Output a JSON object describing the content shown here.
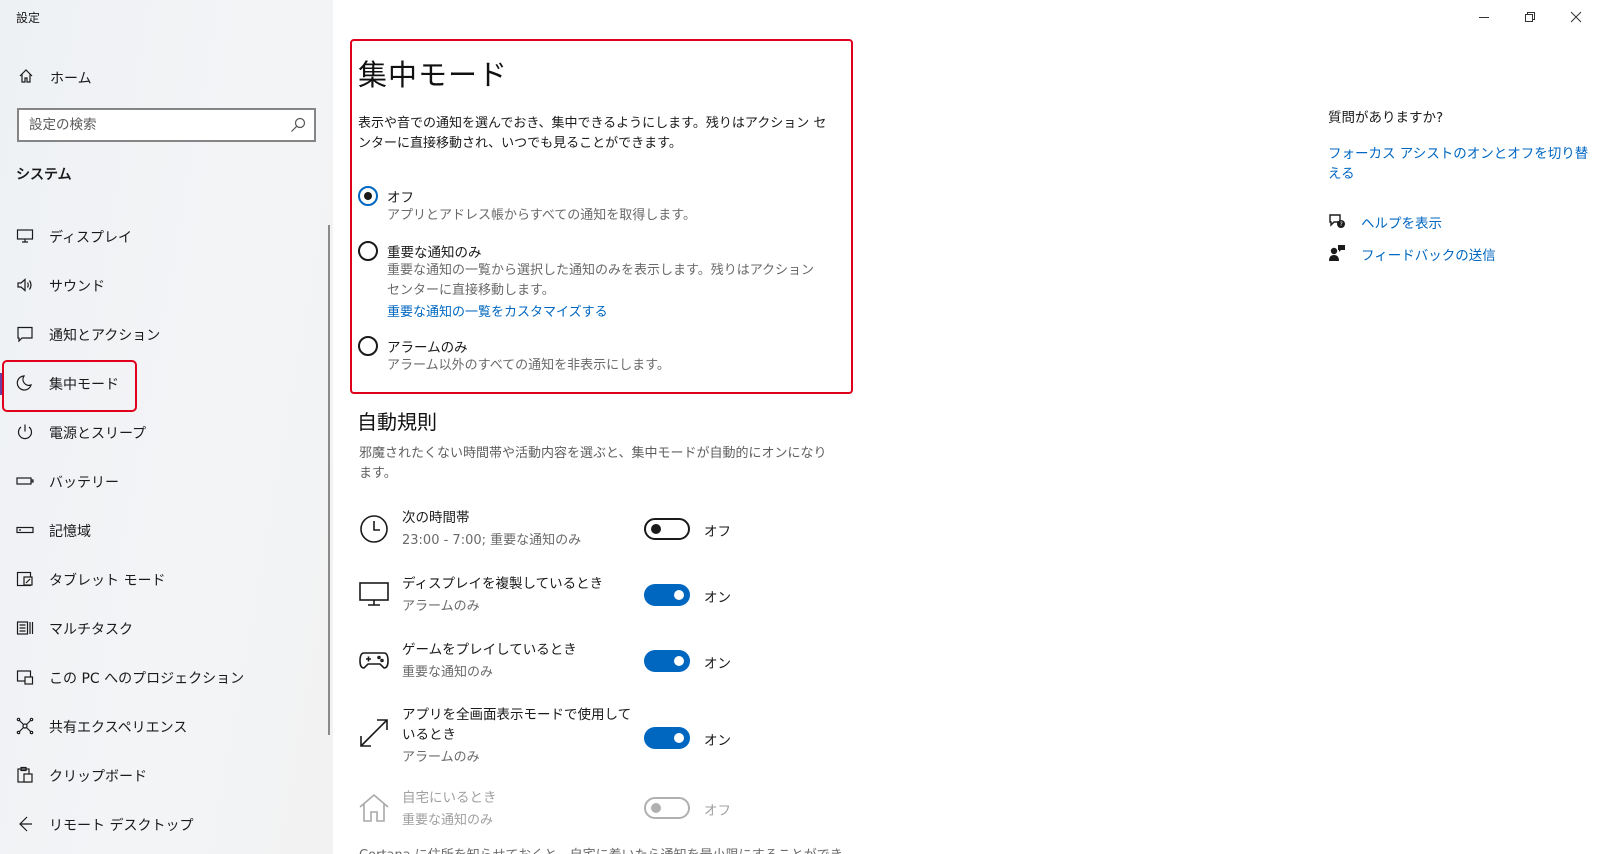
{
  "window": {
    "title": "設定",
    "controls": {
      "minimize": "minimize-icon",
      "restore": "restore-icon",
      "close": "close-icon"
    }
  },
  "sidebar": {
    "home": {
      "icon": "home-icon",
      "label": "ホーム"
    },
    "search": {
      "placeholder": "設定の検索",
      "value": "",
      "icon": "search-icon"
    },
    "section": "システム",
    "items": [
      {
        "icon": "display-icon",
        "label": "ディスプレイ"
      },
      {
        "icon": "sound-icon",
        "label": "サウンド"
      },
      {
        "icon": "notification-icon",
        "label": "通知とアクション"
      },
      {
        "icon": "moon-icon",
        "label": "集中モード",
        "active": true
      },
      {
        "icon": "power-icon",
        "label": "電源とスリープ"
      },
      {
        "icon": "battery-icon",
        "label": "バッテリー"
      },
      {
        "icon": "storage-icon",
        "label": "記憶域"
      },
      {
        "icon": "tablet-icon",
        "label": "タブレット モード"
      },
      {
        "icon": "multitask-icon",
        "label": "マルチタスク"
      },
      {
        "icon": "projection-icon",
        "label": "この PC へのプロジェクション"
      },
      {
        "icon": "shared-experience-icon",
        "label": "共有エクスペリエンス"
      },
      {
        "icon": "clipboard-icon",
        "label": "クリップボード"
      },
      {
        "icon": "remote-desktop-icon",
        "label": "リモート デスクトップ"
      }
    ],
    "highlight_color": "#e0001b",
    "active_bar_color": "#6b3fa0"
  },
  "main": {
    "title": "集中モード",
    "description": "表示や音での通知を選んでおき、集中できるようにします。残りはアクション センターに直接移動され、いつでも見ることができます。",
    "options": [
      {
        "label": "オフ",
        "sub": "アプリとアドレス帳からすべての通知を取得します。",
        "checked": true
      },
      {
        "label": "重要な通知のみ",
        "sub": "重要な通知の一覧から選択した通知のみを表示します。残りはアクション センターに直接移動します。",
        "link": "重要な通知の一覧をカスタマイズする",
        "checked": false
      },
      {
        "label": "アラームのみ",
        "sub": "アラーム以外のすべての通知を非表示にします。",
        "checked": false
      }
    ],
    "auto_rules": {
      "title": "自動規則",
      "description": "邪魔されたくない時間帯や活動内容を選ぶと、集中モードが自動的にオンになります。",
      "rules": [
        {
          "icon": "clock-icon",
          "name": "次の時間帯",
          "sub": "23:00 - 7:00; 重要な通知のみ",
          "on": false,
          "state": "オフ",
          "disabled": false
        },
        {
          "icon": "monitor-icon",
          "name": "ディスプレイを複製しているとき",
          "sub": "アラームのみ",
          "on": true,
          "state": "オン",
          "disabled": false
        },
        {
          "icon": "gamepad-icon",
          "name": "ゲームをプレイしているとき",
          "sub": "重要な通知のみ",
          "on": true,
          "state": "オン",
          "disabled": false
        },
        {
          "icon": "fullscreen-icon",
          "name": "アプリを全画面表示モードで使用しているとき",
          "sub": "アラームのみ",
          "on": true,
          "state": "オン",
          "disabled": false
        },
        {
          "icon": "house-icon",
          "name": "自宅にいるとき",
          "sub": "重要な通知のみ",
          "on": false,
          "state": "オフ",
          "disabled": true
        }
      ],
      "footer": "Cortana に住所を知らせておくと、自宅に着いたら通知を最小限にすることができ"
    },
    "accent_color": "#0067c0"
  },
  "right_panel": {
    "question": "質問がありますか?",
    "link": "フォーカス アシストのオンとオフを切り替える",
    "items": [
      {
        "icon": "help-chat-icon",
        "label": "ヘルプを表示"
      },
      {
        "icon": "feedback-icon",
        "label": "フィードバックの送信"
      }
    ]
  }
}
